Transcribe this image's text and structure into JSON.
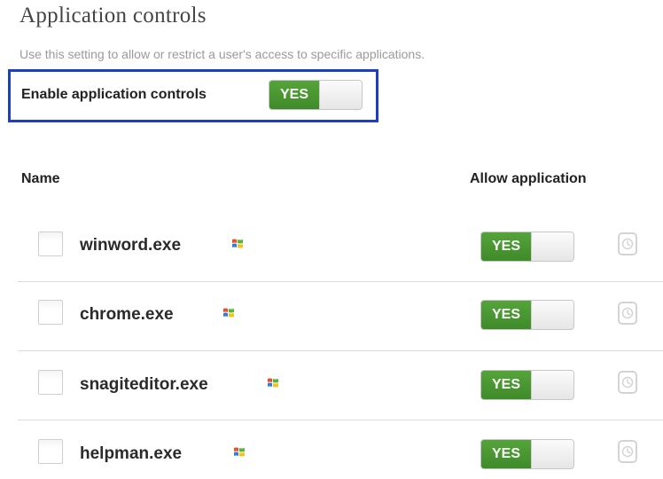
{
  "page": {
    "title": "Application controls",
    "subtitle": "Use this setting to allow or restrict a user's access to specific applications."
  },
  "enable": {
    "label": "Enable application controls",
    "toggle_label": "YES"
  },
  "table": {
    "headers": {
      "name": "Name",
      "allow": "Allow application"
    },
    "rows": [
      {
        "name": "winword.exe",
        "allow_label": "YES",
        "icon": "windows-logo-icon"
      },
      {
        "name": "chrome.exe",
        "allow_label": "YES",
        "icon": "windows-logo-icon"
      },
      {
        "name": "snagiteditor.exe",
        "allow_label": "YES",
        "icon": "windows-logo-icon"
      },
      {
        "name": "helpman.exe",
        "allow_label": "YES",
        "icon": "windows-logo-icon"
      }
    ]
  },
  "colors": {
    "toggle_on": "#4a9a33",
    "highlight_border": "#1c3fc2"
  }
}
